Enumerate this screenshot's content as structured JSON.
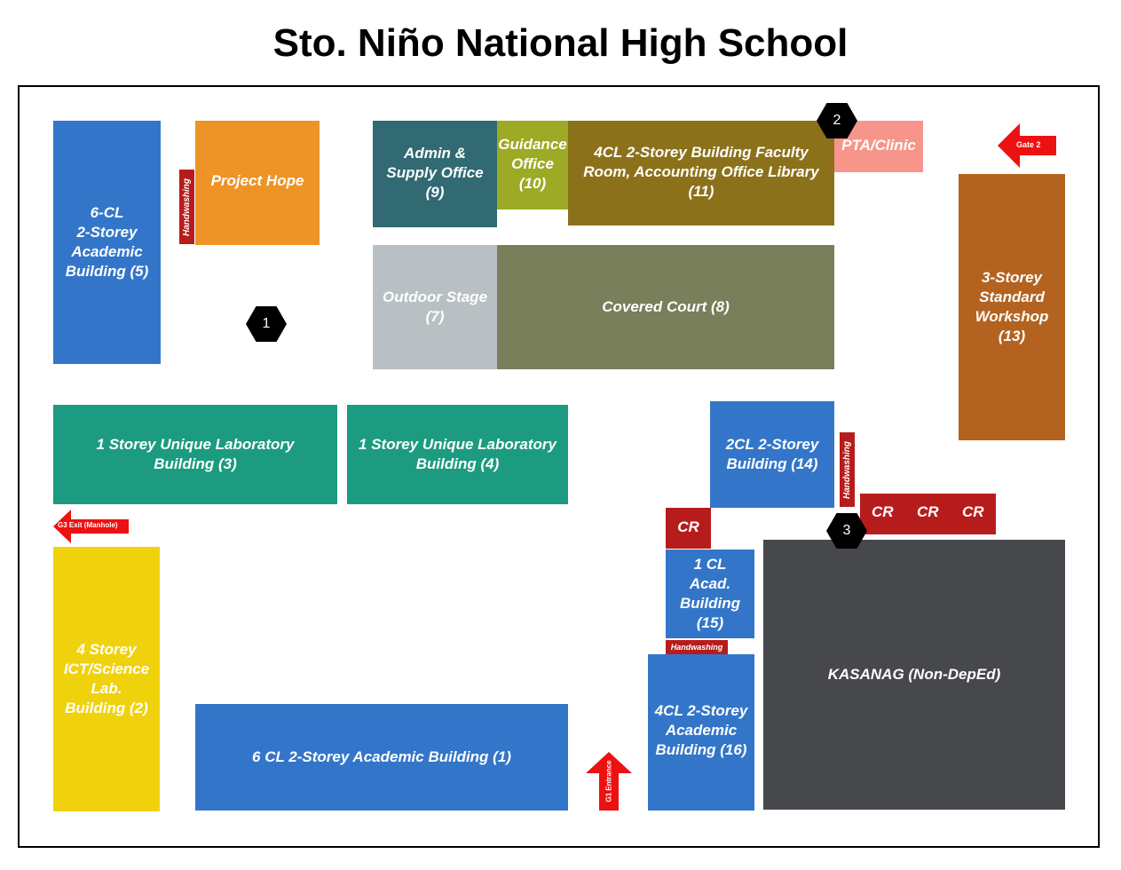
{
  "title": "Sto. Niño National High School",
  "colors": {
    "blue": "#3376c9",
    "orange": "#ee9325",
    "teal_dark": "#316a73",
    "olive_green": "#9caa25",
    "olive_brown": "#8c711b",
    "salmon": "#f8958a",
    "brown": "#b3631f",
    "gray_light": "#b8c0c3",
    "gray_green": "#787f5a",
    "teal": "#1c9b80",
    "yellow": "#f0d20c",
    "dark_gray": "#47484b",
    "red": "#b71c1c",
    "arrow_red": "#ee1111"
  },
  "buildings": {
    "b5": "6-CL\n2-Storey\nAcademic\nBuilding (5)",
    "project_hope": "Project Hope",
    "b9": "Admin &\nSupply Office\n(9)",
    "b10": "Guidance\nOffice\n(10)",
    "b11": "4CL 2-Storey Building Faculty\nRoom, Accounting Office Library\n(11)",
    "pta": "PTA/Clinic",
    "b13": "3-Storey\nStandard\nWorkshop\n(13)",
    "b7": "Outdoor Stage\n(7)",
    "b8": "Covered Court (8)",
    "b3": "1 Storey Unique Laboratory\nBuilding (3)",
    "b4": "1 Storey Unique Laboratory\nBuilding (4)",
    "b14": "2CL 2-Storey\nBuilding (14)",
    "b2": "4 Storey\nICT/Science\nLab.\nBuilding (2)",
    "b15": "1 CL\nAcad.\nBuilding\n(15)",
    "b16": "4CL 2-Storey\nAcademic\nBuilding (16)",
    "kasanag": "KASANAG (Non-DepEd)",
    "b1": "6 CL 2-Storey Academic Building (1)"
  },
  "facilities": {
    "handwashing": "Handwashing",
    "cr": "CR"
  },
  "markers": [
    "1",
    "2",
    "3"
  ],
  "gates": {
    "gate2": "Gate 2",
    "g3": "G3 Exit (Manhole)",
    "g1": "G1 Entrance"
  },
  "icons": {
    "marker": "hexagon-marker-icon",
    "arrow": "arrow-icon"
  }
}
